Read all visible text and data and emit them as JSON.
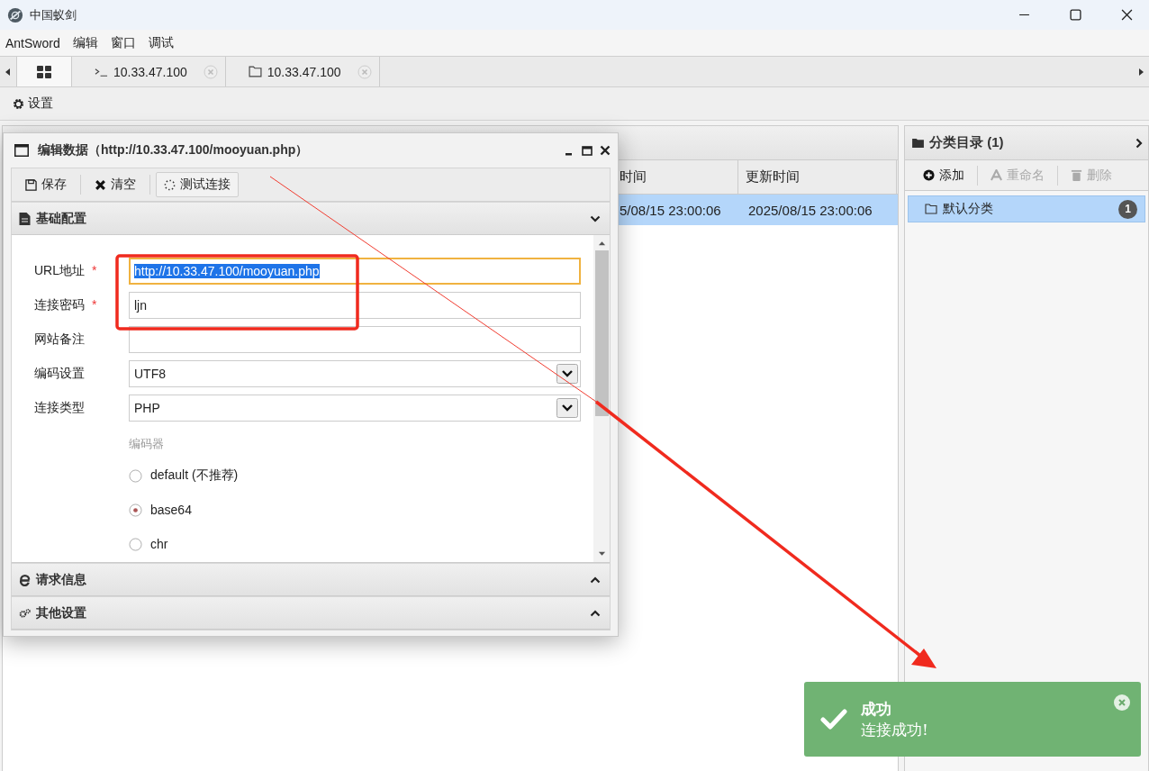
{
  "window": {
    "title": "中国蚁剑"
  },
  "menu": [
    "AntSword",
    "编辑",
    "窗口",
    "调试"
  ],
  "tabs": [
    {
      "kind": "home",
      "selected": true
    },
    {
      "kind": "terminal",
      "label": "10.33.47.100",
      "selected": false
    },
    {
      "kind": "folder",
      "label": "10.33.47.100",
      "selected": false
    }
  ],
  "toolbar": {
    "settings": "设置"
  },
  "grid": {
    "columns": [
      "时间",
      "更新时间"
    ],
    "rows": [
      {
        "cells": [
          "5/08/15 23:00:06",
          "2025/08/15 23:00:06"
        ],
        "selected": true
      }
    ]
  },
  "category_panel": {
    "title": "分类目录 (1)",
    "actions": [
      {
        "kind": "add",
        "label": "添加",
        "disabled": false
      },
      {
        "kind": "rename",
        "label": "重命名",
        "disabled": true
      },
      {
        "kind": "delete",
        "label": "删除",
        "disabled": true
      }
    ],
    "items": [
      {
        "label": "默认分类",
        "count": "1",
        "selected": true
      }
    ]
  },
  "dialog": {
    "title": "编辑数据（http://10.33.47.100/mooyuan.php）",
    "toolbar": [
      {
        "kind": "save",
        "label": "保存"
      },
      {
        "kind": "clear",
        "label": "清空"
      },
      {
        "kind": "test",
        "label": "测试连接"
      }
    ],
    "sections": [
      {
        "kind": "doc",
        "title": "基础配置",
        "expanded": true
      },
      {
        "kind": "request",
        "title": "请求信息",
        "expanded": false
      },
      {
        "kind": "other",
        "title": "其他设置",
        "expanded": false
      }
    ],
    "fields": [
      {
        "kind": "text",
        "label": "URL地址",
        "required_mark": "*",
        "value": "http://10.33.47.100/mooyuan.php",
        "focused": true
      },
      {
        "kind": "text",
        "label": "连接密码",
        "required_mark": "*",
        "value": "ljn",
        "focused": false
      },
      {
        "kind": "text",
        "label": "网站备注"
      },
      {
        "kind": "select",
        "label": "编码设置",
        "value": "UTF8"
      },
      {
        "kind": "select",
        "label": "连接类型",
        "value": "PHP"
      }
    ],
    "encoder": {
      "label": "编码器",
      "options": [
        {
          "label": "default (不推荐)",
          "selected": false
        },
        {
          "label": "base64",
          "selected": true
        },
        {
          "label": "chr",
          "selected": false
        }
      ]
    }
  },
  "toast": {
    "title": "成功",
    "message": "连接成功!"
  }
}
